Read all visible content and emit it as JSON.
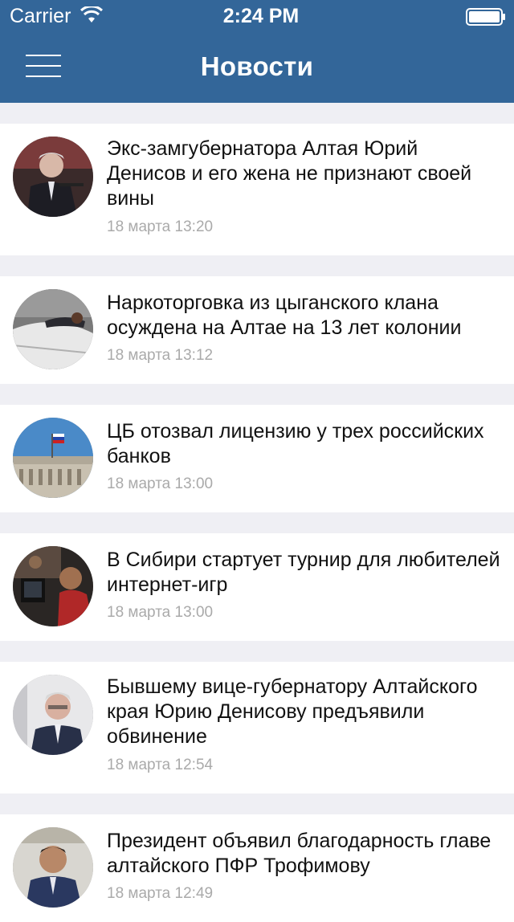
{
  "status_bar": {
    "carrier": "Carrier",
    "time": "2:24 PM",
    "icons": [
      "wifi-icon",
      "battery-icon"
    ]
  },
  "nav": {
    "title": "Новости",
    "menu_icon": "hamburger-menu-icon",
    "bar_color": "#336699"
  },
  "news": [
    {
      "headline": "Экс-замгубернатора Алтая Юрий Денисов и его жена не признают своей вины",
      "date": "18 марта 13:20",
      "thumbnail": "man-at-podium-photo"
    },
    {
      "headline": "Наркоторговка из цыганского клана осуждена на Алтае на 13 лет колонии",
      "date": "18 марта 13:12",
      "thumbnail": "person-on-car-hood-photo"
    },
    {
      "headline": "ЦБ отозвал лицензию у трех российских банков",
      "date": "18 марта 13:00",
      "thumbnail": "central-bank-building-photo"
    },
    {
      "headline": "В Сибири стартует турнир для любителей интернет-игр",
      "date": "18 марта 13:00",
      "thumbnail": "gamers-at-computers-photo"
    },
    {
      "headline": "Бывшему вице-губернатору Алтайского края Юрию Денисову предъявили обвинение",
      "date": "18 марта 12:54",
      "thumbnail": "man-in-suit-photo"
    },
    {
      "headline": "Президент объявил благодарность главе алтайского ПФР Трофимову",
      "date": "18 марта 12:49",
      "thumbnail": "official-portrait-photo"
    }
  ]
}
